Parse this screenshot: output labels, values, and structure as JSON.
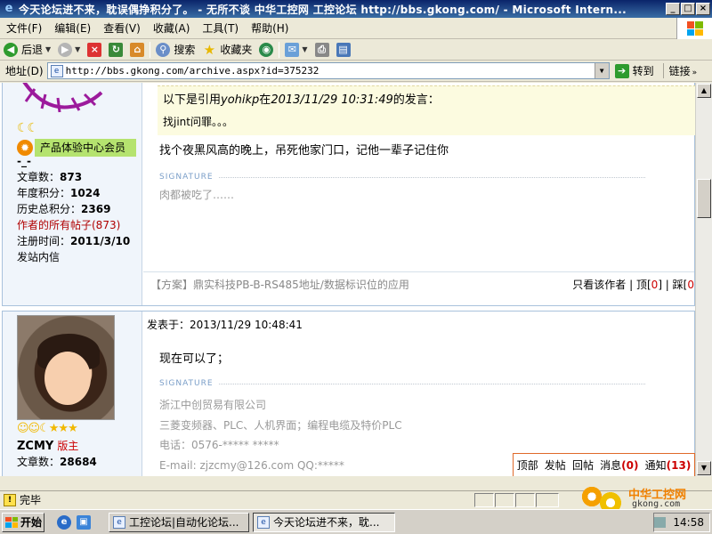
{
  "window": {
    "title": "今天论坛进不来，耽误偶挣积分了。 - 无所不谈  中华工控网 工控论坛 http://bbs.gkong.com/ - Microsoft Intern...",
    "min": "_",
    "max": "□",
    "close": "×"
  },
  "menu": [
    "文件(F)",
    "编辑(E)",
    "查看(V)",
    "收藏(A)",
    "工具(T)",
    "帮助(H)"
  ],
  "toolbar": {
    "back": "后退",
    "search": "搜索",
    "favorites": "收藏夹"
  },
  "address": {
    "label": "地址(D)",
    "url": "http://bbs.gkong.com/archive.aspx?id=375232",
    "go": "转到",
    "links": "链接"
  },
  "post1": {
    "role": "产品体验中心会员",
    "dash": "-_-",
    "stats": {
      "articles_label": "文章数：",
      "articles": "873",
      "year_label": "年度积分：",
      "year": "1024",
      "history_label": "历史总积分：",
      "history": "2369",
      "all_posts": "作者的所有帖子(873)",
      "reg_label": "注册时间：",
      "reg": "2011/3/10",
      "msg": "发站内信"
    },
    "quote_prefix": "以下是引用",
    "quote_user": "yohikp",
    "quote_mid": "在",
    "quote_time": "2013/11/29 10:31:49",
    "quote_suffix": "的发言：",
    "quote_body": "找jint问罪。。。",
    "text": "找个夜黑风高的晚上，吊死他家门口，记他一辈子记住你",
    "sig_label": "SIGNATURE",
    "signature": "肉都被吃了……",
    "footer_title": "【方案】鼎实科技PB-B-RS485地址/数据标识位的应用",
    "footer_author": "只看该作者",
    "footer_top_pre": " | 顶[",
    "footer_top": "0",
    "footer_top_post": "] | 踩[",
    "footer_down": "0"
  },
  "post2": {
    "posted_label": "发表于：",
    "posted": "2013/11/29 10:48:41",
    "username": "ZCMY",
    "mod": "版主",
    "articles_label": "文章数：",
    "articles": "28684",
    "text": "现在可以了；",
    "sig_label": "SIGNATURE",
    "sig_lines": [
      "浙江中创贸易有限公司",
      "三菱变频器、PLC、人机界面；编程电缆及特价PLC",
      "电话：0576-*****        *****",
      "E-mail: zjzcmy@126.com      QQ:*****"
    ]
  },
  "floatbar": {
    "top": "顶部",
    "post": "发帖",
    "reply": "回帖",
    "msg": "消息",
    "msg_n": "(0)",
    "notify": "通知",
    "notify_n": "(13)"
  },
  "status": {
    "text": "完毕",
    "brand1": "中华工控网",
    "brand2": "gkong.com"
  },
  "taskbar": {
    "start": "开始",
    "task1": "工控论坛|自动化论坛...",
    "task2": "今天论坛进不来，耽...",
    "clock": "14:58"
  }
}
